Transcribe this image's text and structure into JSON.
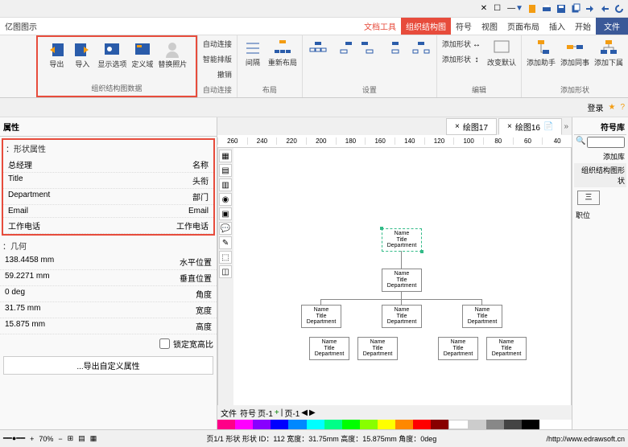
{
  "titlebar": {
    "app_title": "亿图图示"
  },
  "menu": {
    "file": "文件",
    "tabs": [
      "开始",
      "插入",
      "页面布局",
      "视图",
      "符号",
      "组织结构图",
      "文档工具"
    ],
    "active_index": 5
  },
  "ribbon": {
    "group1": {
      "label": "组织结构图数据",
      "btns": {
        "export": "导出",
        "import": "导入",
        "display": "显示选项",
        "define": "定义域",
        "replace": "替换照片"
      }
    },
    "group2": {
      "label": "自动连接",
      "btns": {
        "autoconnect": "自动连接",
        "smart": "智能排版",
        "redo": "撤销"
      }
    },
    "group3": {
      "label": "布局",
      "btns": {
        "relayout": "重新布局",
        "interval": "间隔"
      }
    },
    "group4": {
      "label": "设置"
    },
    "group5": {
      "label": "编辑",
      "btns": {
        "nochange": "改变默认",
        "m1": "添加形状",
        "m2": "添加形状"
      }
    },
    "group6": {
      "label": "添加形状",
      "btns": {
        "b1": "添加下属",
        "b2": "添加同事",
        "b3": "添加助手"
      }
    }
  },
  "quick": {
    "login": "登录",
    "help": "?"
  },
  "doctabs": {
    "t1": "绘图16",
    "t2": "绘图17"
  },
  "ruler": [
    "40",
    "60",
    "80",
    "100",
    "120",
    "140",
    "160",
    "180",
    "200",
    "220",
    "240",
    "260"
  ],
  "org": {
    "node": {
      "l1": "Name",
      "l2": "Title",
      "l3": "Department"
    }
  },
  "right_panel": {
    "title": "符号库",
    "search_tab": "添加库",
    "section": "组织结构图形状",
    "shape": "三",
    "pos": "职位"
  },
  "left_panel": {
    "title": "属性",
    "sec1": "形状属性：",
    "rows1": [
      {
        "k": "名称",
        "v": "总经理"
      },
      {
        "k": "头衔",
        "v": "Title"
      },
      {
        "k": "部门",
        "v": "Department"
      },
      {
        "k": "Email",
        "v": "Email"
      },
      {
        "k": "工作电话",
        "v": "工作电话"
      }
    ],
    "sec2": "几何：",
    "rows2": [
      {
        "k": "水平位置",
        "v": "138.4458 mm"
      },
      {
        "k": "垂直位置",
        "v": "59.2271 mm"
      },
      {
        "k": "角度",
        "v": "0 deg"
      },
      {
        "k": "宽度",
        "v": "31.75 mm"
      },
      {
        "k": "高度",
        "v": "15.875 mm"
      }
    ],
    "protect": "锁定宽高比",
    "custom_btn": "导出自定义属性..."
  },
  "page_tabs": {
    "p1": "页-1",
    "p2": "页-1"
  },
  "statusbar": {
    "url": "http://www.edrawsoft.cn/",
    "info": "页1/1  形状 形状 ID：112  宽度：31.75mm  高度：15.875mm  角度：0deg",
    "zoom": "70%"
  },
  "bottom_tabs": {
    "t1": "符号",
    "t2": "文件"
  }
}
